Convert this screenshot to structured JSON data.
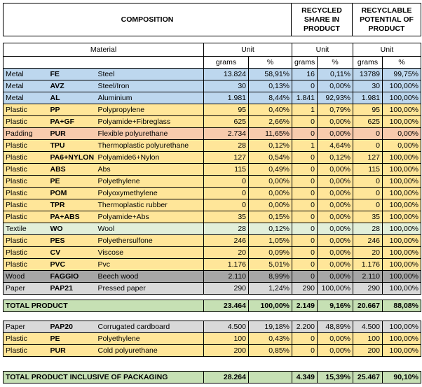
{
  "header": {
    "composition": "COMPOSITION",
    "recycled_share": [
      "RECYCLED",
      "SHARE IN",
      "PRODUCT"
    ],
    "recyclable_potential": [
      "RECYCLABLE",
      "POTENTIAL OF",
      "PRODUCT"
    ]
  },
  "subheader": {
    "material": "Material",
    "unit1": "Unit",
    "unit2": "Unit",
    "unit3": "Unit",
    "grams": "grams",
    "pct": "%"
  },
  "rows": [
    {
      "cat": "Metal",
      "code": "FE",
      "name": "Steel",
      "g": "13.824",
      "p": "58,91%",
      "rg": "16",
      "rp": "0,11%",
      "pg": "13789",
      "pp": "99,75%",
      "color": "blue"
    },
    {
      "cat": "Metal",
      "code": "AVZ",
      "name": "Steel/Iron",
      "g": "30",
      "p": "0,13%",
      "rg": "0",
      "rp": "0,00%",
      "pg": "30",
      "pp": "100,00%",
      "color": "blue"
    },
    {
      "cat": "Metal",
      "code": "AL",
      "name": "Aluminium",
      "g": "1.981",
      "p": "8,44%",
      "rg": "1.841",
      "rp": "92,93%",
      "pg": "1.981",
      "pp": "100,00%",
      "color": "blue"
    },
    {
      "cat": "Plastic",
      "code": "PP",
      "name": "Polypropylene",
      "g": "95",
      "p": "0,40%",
      "rg": "1",
      "rp": "0,79%",
      "pg": "95",
      "pp": "100,00%",
      "color": "yellow"
    },
    {
      "cat": "Plastic",
      "code": "PA+GF",
      "name": "Polyamide+Fibreglass",
      "g": "625",
      "p": "2,66%",
      "rg": "0",
      "rp": "0,00%",
      "pg": "625",
      "pp": "100,00%",
      "color": "yellow"
    },
    {
      "cat": "Padding",
      "code": "PUR",
      "name": "Flexible polyurethane",
      "g": "2.734",
      "p": "11,65%",
      "rg": "0",
      "rp": "0,00%",
      "pg": "0",
      "pp": "0,00%",
      "color": "salmon"
    },
    {
      "cat": "Plastic",
      "code": "TPU",
      "name": "Thermoplastic polyurethane",
      "g": "28",
      "p": "0,12%",
      "rg": "1",
      "rp": "4,64%",
      "pg": "0",
      "pp": "0,00%",
      "color": "yellow"
    },
    {
      "cat": "Plastic",
      "code": "PA6+NYLON",
      "name": "Polyamide6+Nylon",
      "g": "127",
      "p": "0,54%",
      "rg": "0",
      "rp": "0,12%",
      "pg": "127",
      "pp": "100,00%",
      "color": "yellow"
    },
    {
      "cat": "Plastic",
      "code": "ABS",
      "name": "Abs",
      "g": "115",
      "p": "0,49%",
      "rg": "0",
      "rp": "0,00%",
      "pg": "115",
      "pp": "100,00%",
      "color": "yellow"
    },
    {
      "cat": "Plastic",
      "code": "PE",
      "name": "Polyethylene",
      "g": "0",
      "p": "0,00%",
      "rg": "0",
      "rp": "0,00%",
      "pg": "0",
      "pp": "100,00%",
      "color": "yellow"
    },
    {
      "cat": "Plastic",
      "code": "POM",
      "name": "Polyoxymethylene",
      "g": "0",
      "p": "0,00%",
      "rg": "0",
      "rp": "0,00%",
      "pg": "0",
      "pp": "100,00%",
      "color": "yellow"
    },
    {
      "cat": "Plastic",
      "code": "TPR",
      "name": "Thermoplastic rubber",
      "g": "0",
      "p": "0,00%",
      "rg": "0",
      "rp": "0,00%",
      "pg": "0",
      "pp": "100,00%",
      "color": "yellow"
    },
    {
      "cat": "Plastic",
      "code": "PA+ABS",
      "name": "Polyamide+Abs",
      "g": "35",
      "p": "0,15%",
      "rg": "0",
      "rp": "0,00%",
      "pg": "35",
      "pp": "100,00%",
      "color": "yellow"
    },
    {
      "cat": "Textile",
      "code": "WO",
      "name": "Wool",
      "g": "28",
      "p": "0,12%",
      "rg": "0",
      "rp": "0,00%",
      "pg": "28",
      "pp": "100,00%",
      "color": "lgreen"
    },
    {
      "cat": "Plastic",
      "code": "PES",
      "name": "Polyethersulfone",
      "g": "246",
      "p": "1,05%",
      "rg": "0",
      "rp": "0,00%",
      "pg": "246",
      "pp": "100,00%",
      "color": "yellow"
    },
    {
      "cat": "Plastic",
      "code": "CV",
      "name": "Viscose",
      "g": "20",
      "p": "0,09%",
      "rg": "0",
      "rp": "0,00%",
      "pg": "20",
      "pp": "100,00%",
      "color": "yellow"
    },
    {
      "cat": "Plastic",
      "code": "PVC",
      "name": "Pvc",
      "g": "1.176",
      "p": "5,01%",
      "rg": "0",
      "rp": "0,00%",
      "pg": "1.176",
      "pp": "100,00%",
      "color": "yellow"
    },
    {
      "cat": "Wood",
      "code": "FAGGIO",
      "name": "Beech wood",
      "g": "2.110",
      "p": "8,99%",
      "rg": "0",
      "rp": "0,00%",
      "pg": "2.110",
      "pp": "100,00%",
      "color": "gray"
    },
    {
      "cat": "Paper",
      "code": "PAP21",
      "name": "Pressed paper",
      "g": "290",
      "p": "1,24%",
      "rg": "290",
      "rp": "100,00%",
      "pg": "290",
      "pp": "100,00%",
      "color": "lgray"
    }
  ],
  "total_product": {
    "label": "TOTAL PRODUCT",
    "g": "23.464",
    "p": "100,00%",
    "rg": "2.149",
    "rp": "9,16%",
    "pg": "20.667",
    "pp": "88,08%"
  },
  "packaging_rows": [
    {
      "cat": "Paper",
      "code": "PAP20",
      "name": "Corrugated cardboard",
      "g": "4.500",
      "p": "19,18%",
      "rg": "2.200",
      "rp": "48,89%",
      "pg": "4.500",
      "pp": "100,00%",
      "color": "lgray"
    },
    {
      "cat": "Plastic",
      "code": "PE",
      "name": "Polyethylene",
      "g": "100",
      "p": "0,43%",
      "rg": "0",
      "rp": "0,00%",
      "pg": "100",
      "pp": "100,00%",
      "color": "yellow"
    },
    {
      "cat": "Plastic",
      "code": "PUR",
      "name": "Cold polyurethane",
      "g": "200",
      "p": "0,85%",
      "rg": "0",
      "rp": "0,00%",
      "pg": "200",
      "pp": "100,00%",
      "color": "yellow"
    }
  ],
  "total_packaging": {
    "label": "TOTAL PRODUCT INCLUSIVE OF PACKAGING",
    "g": "28.264",
    "p": "",
    "rg": "4.349",
    "rp": "15,39%",
    "pg": "25.467",
    "pp": "90,10%"
  }
}
